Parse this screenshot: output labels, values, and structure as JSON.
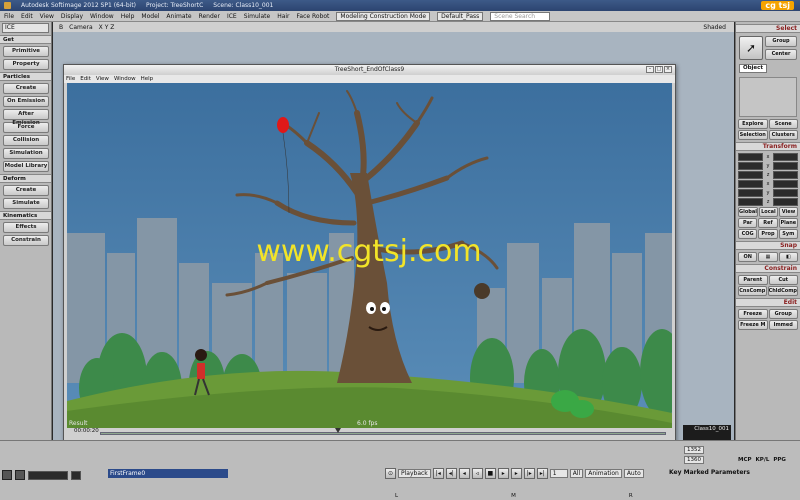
{
  "app": {
    "title": "Autodesk Softimage 2012 SP1 (64-bit)",
    "project": "Project: TreeShortC",
    "scene": "Scene: Class10_001",
    "logo": "cg tsj"
  },
  "menubar": {
    "items": [
      "File",
      "Edit",
      "View",
      "Display",
      "Window",
      "Help",
      "Model",
      "Animate",
      "Render",
      "ICE",
      "Simulate",
      "Hair",
      "Face Robot"
    ],
    "layout_combo": "Modeling Construction Mode",
    "pass_combo": "Default_Pass",
    "search_placeholder": "Scene Search"
  },
  "left_panel": {
    "mode": "ICE",
    "items": [
      {
        "type": "head",
        "label": "Get"
      },
      {
        "type": "btn",
        "label": "Primitive"
      },
      {
        "type": "btn",
        "label": "Property"
      },
      {
        "type": "head",
        "label": "Particles"
      },
      {
        "type": "btn",
        "label": "Create"
      },
      {
        "type": "btn",
        "label": "On Emission"
      },
      {
        "type": "btn",
        "label": "After Emission"
      },
      {
        "type": "btn",
        "label": "Force"
      },
      {
        "type": "btn",
        "label": "Collision"
      },
      {
        "type": "btn",
        "label": "Simulation"
      },
      {
        "type": "btn",
        "label": "Model Library"
      },
      {
        "type": "head",
        "label": "Deform"
      },
      {
        "type": "btn",
        "label": "Create"
      },
      {
        "type": "btn",
        "label": "Simulate"
      },
      {
        "type": "head",
        "label": "Kinematics"
      },
      {
        "type": "btn",
        "label": "Effects"
      },
      {
        "type": "btn",
        "label": "Constrain"
      }
    ]
  },
  "viewport": {
    "letter": "B",
    "camera": "Camera",
    "axes": "X Y Z",
    "shading": "Shaded"
  },
  "player": {
    "title": "TreeShort_EndOfClass9",
    "menu": [
      "File",
      "Edit",
      "View",
      "Window",
      "Help"
    ],
    "result_label": "Result",
    "fps": "6.0 fps",
    "watermark": "www.cgtsj.com",
    "timecode": "00:00:20",
    "progress": 0.42
  },
  "overlay": {
    "line1": "Class10_001"
  },
  "right_panel": {
    "select_label": "Select",
    "group_btn": "Group",
    "center_btn": "Center",
    "object_tab": "Object",
    "explore_btn": "Explore",
    "scene_btn": "Scene",
    "selection_btn": "Selection",
    "clusters_btn": "Clusters",
    "transform_label": "Transform",
    "global_btn": "Global",
    "local_btn": "Local",
    "view_btn": "View",
    "par_btn": "Par",
    "ref_btn": "Ref",
    "plane_btn": "Plane",
    "cog_btn": "COG",
    "prop_btn": "Prop",
    "sym_btn": "Sym",
    "snap_label": "Snap",
    "on_btn": "ON",
    "constrain_label": "Constrain",
    "parent_btn": "Parent",
    "cut_btn": "Cut",
    "cnscomp_btn": "CnsComp",
    "chldcomp_btn": "ChldComp",
    "edit_label": "Edit",
    "freeze_btn": "Freeze",
    "group2_btn": "Group",
    "freezem_btn": "Freeze M",
    "immed_btn": "Immed"
  },
  "timeline": {
    "first_frame": "FirstFrame0",
    "playback_label": "Playback",
    "frame_a": "1352",
    "frame_b": "1360",
    "frame_c": "1",
    "all_label": "All",
    "animation_label": "Animation",
    "auto_label": "Auto",
    "kmp_label": "Key Marked Parameters",
    "mcp_tab": "MCP",
    "kpl_tab": "KP/L",
    "ppg_tab": "PPG",
    "scale_marks": [
      "L",
      "M",
      "R"
    ]
  }
}
